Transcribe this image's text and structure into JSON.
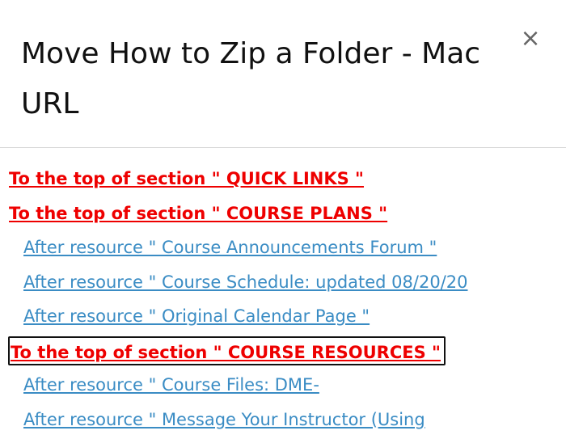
{
  "dialog": {
    "title": "Move How to Zip a Folder - Mac URL",
    "close_icon": "×"
  },
  "move_targets": [
    {
      "type": "section",
      "label": "To the top of section \" QUICK LINKS \""
    },
    {
      "type": "section",
      "label": "To the top of section \" COURSE PLANS \""
    },
    {
      "type": "resource",
      "label": "After resource \" Course Announcements Forum \""
    },
    {
      "type": "resource",
      "label": "After resource \" Course Schedule: updated 08/20/20"
    },
    {
      "type": "resource",
      "label": "After resource \" Original Calendar Page \""
    },
    {
      "type": "section",
      "label": "To the top of section \" COURSE RESOURCES \"",
      "focused": true
    },
    {
      "type": "resource",
      "label": "After resource \" Course Files: DME-"
    },
    {
      "type": "resource",
      "label": "After resource \" Message Your Instructor (Using"
    }
  ],
  "colors": {
    "section_link": "#ee0000",
    "resource_link": "#3a8cc4",
    "title": "#111111"
  }
}
